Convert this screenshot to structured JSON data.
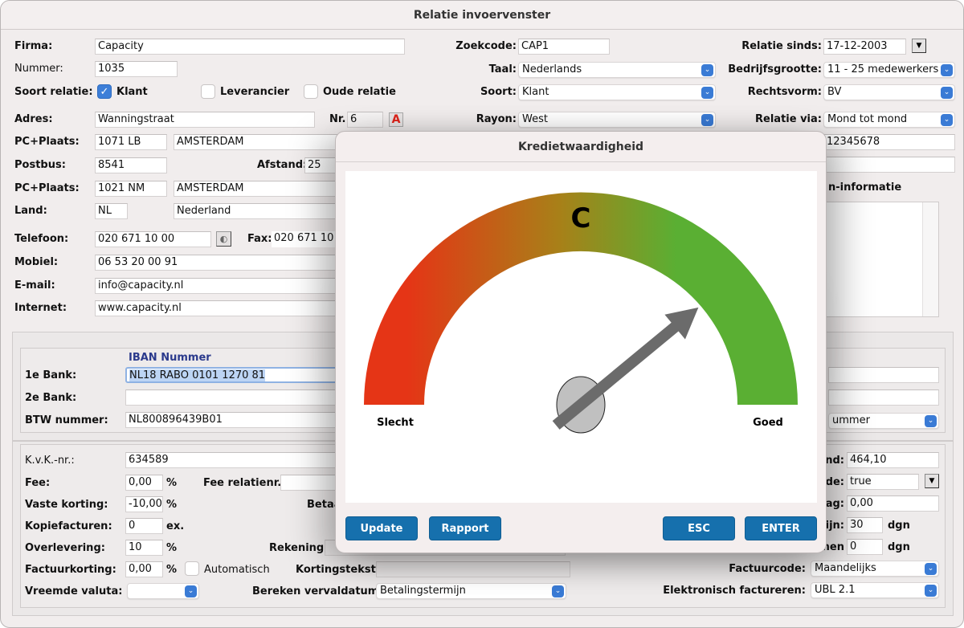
{
  "window": {
    "title": "Relatie invoervenster"
  },
  "left": {
    "firma": {
      "label": "Firma:",
      "value": "Capacity"
    },
    "nummer": {
      "label": "Nummer:",
      "value": "1035"
    },
    "soort_relatie": {
      "label": "Soort relatie:",
      "options": [
        {
          "label": "Klant",
          "checked": true
        },
        {
          "label": "Leverancier",
          "checked": false
        },
        {
          "label": "Oude relatie",
          "checked": false
        }
      ]
    },
    "adres": {
      "label": "Adres:",
      "value": "Wanningstraat",
      "nr_label": "Nr.",
      "nr_value": "6"
    },
    "pc_plaats_1": {
      "label": "PC+Plaats:",
      "postcode": "1071 LB",
      "plaats": "AMSTERDAM"
    },
    "postbus": {
      "label": "Postbus:",
      "value": "8541",
      "afstand_label": "Afstand:",
      "afstand_value": "25"
    },
    "pc_plaats_2": {
      "label": "PC+Plaats:",
      "postcode": "1021 NM",
      "plaats": "AMSTERDAM"
    },
    "land": {
      "label": "Land:",
      "code": "NL",
      "name": "Nederland"
    },
    "telefoon": {
      "label": "Telefoon:",
      "value": "020 671 10 00",
      "fax_label": "Fax:",
      "fax_value": "020 671 10"
    },
    "mobiel": {
      "label": "Mobiel:",
      "value": "06 53 20 00 91"
    },
    "email": {
      "label": "E-mail:",
      "value": "info@capacity.nl"
    },
    "internet": {
      "label": "Internet:",
      "value": "www.capacity.nl"
    }
  },
  "middle": {
    "zoekcode": {
      "label": "Zoekcode:",
      "value": "CAP1"
    },
    "taal": {
      "label": "Taal:",
      "value": "Nederlands"
    },
    "soort": {
      "label": "Soort:",
      "value": "Klant"
    },
    "rayon": {
      "label": "Rayon:",
      "value": "West"
    }
  },
  "right": {
    "relatie_sinds": {
      "label": "Relatie sinds:",
      "value": "17-12-2003"
    },
    "bedrijfsgrootte": {
      "label": "Bedrijfsgrootte:",
      "value": "11 - 25 medewerkers"
    },
    "rechtsvorm": {
      "label": "Rechtsvorm:",
      "value": "BV"
    },
    "relatie_via": {
      "label": "Relatie via:",
      "value": "Mond tot mond"
    },
    "field_1": "12345678",
    "field_2": "",
    "info_heading": "n-informatie"
  },
  "bank": {
    "iban_header": "IBAN Nummer",
    "bank1": {
      "label": "1e Bank:",
      "value": "NL18 RABO 0101 1270 81"
    },
    "bank2": {
      "label": "2e Bank:",
      "value": ""
    },
    "btw": {
      "label": "BTW nummer:",
      "value": "NL800896439B01"
    },
    "right_select": "ummer"
  },
  "finance": {
    "kvk": {
      "label": "K.v.K.-nr.:",
      "value": "634589"
    },
    "fee": {
      "label": "Fee:",
      "value": "0,00",
      "unit": "%",
      "relatienr_label": "Fee relatienr.:",
      "relatienr_value": ""
    },
    "vaste_korting": {
      "label": "Vaste korting:",
      "value": "-10,00",
      "unit": "%",
      "betaal_label": "Betaa"
    },
    "kopiefacturen": {
      "label": "Kopiefacturen:",
      "value": "0",
      "unit": "ex."
    },
    "overlevering": {
      "label": "Overlevering:",
      "value": "10",
      "unit": "%",
      "rekening_label": "Rekening:"
    },
    "factuurkorting": {
      "label": "Factuurkorting:",
      "value": "0,00",
      "unit": "%",
      "automatisch_label": "Automatisch",
      "automatisch_checked": false,
      "kortingstekst_label": "Kortingstekst:",
      "kortingstekst_value": ""
    },
    "vreemde_valuta": {
      "label": "Vreemde valuta:",
      "value": ""
    },
    "bereken_vervaldatum": {
      "label": "Bereken vervaldatum:",
      "value": "Betalingstermijn"
    },
    "right": {
      "nd": {
        "label": "nd:",
        "value": "464,10"
      },
      "de": {
        "label": "de:",
        "value": "true"
      },
      "ag": {
        "label": "ag:",
        "value": "0,00"
      },
      "ijn": {
        "label": "ijn:",
        "value": "30",
        "unit": "dgn"
      },
      "hen": {
        "label": "hen",
        "value": "0",
        "unit": "dgn"
      },
      "factuurcode": {
        "label": "Factuurcode:",
        "value": "Maandelijks"
      },
      "elektronisch": {
        "label": "Elektronisch factureren:",
        "value": "UBL 2.1"
      }
    }
  },
  "modal": {
    "title": "Kredietwaardigheid",
    "gauge": {
      "grade": "C",
      "low_label": "Slecht",
      "high_label": "Goed",
      "value_fraction": 0.78,
      "colors": {
        "low": "#e53516",
        "mid": "#a88018",
        "high": "#5aaf33",
        "needle": "#6b6b6b",
        "hub": "#c0c0c0"
      }
    },
    "buttons": {
      "update": "Update",
      "rapport": "Rapport",
      "esc": "ESC",
      "enter": "ENTER"
    }
  }
}
